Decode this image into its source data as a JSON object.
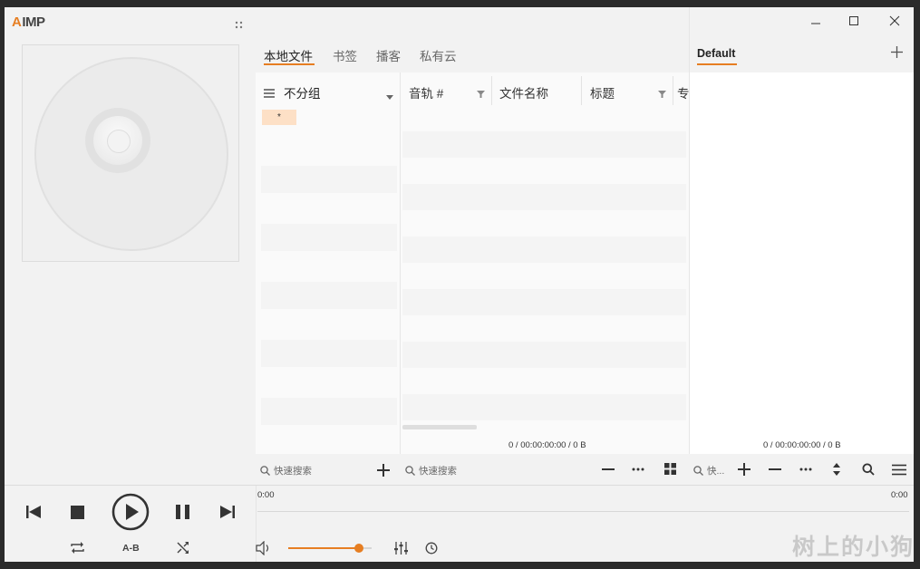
{
  "app": {
    "logo_text": "IMP",
    "logo_accent": "A",
    "accent_color": "#e67e22"
  },
  "tabs": [
    {
      "label": "本地文件",
      "active": true
    },
    {
      "label": "书签",
      "active": false
    },
    {
      "label": "播客",
      "active": false
    },
    {
      "label": "私有云",
      "active": false
    }
  ],
  "grouping": {
    "label": "不分组",
    "all_item": "*"
  },
  "columns": [
    {
      "label": "音轨 #"
    },
    {
      "label": "文件名称"
    },
    {
      "label": "标题"
    },
    {
      "label": "专"
    }
  ],
  "library_status": "0 / 00:00:00:00 / 0 B",
  "playlist": {
    "tab_label": "Default",
    "status": "0 / 00:00:00:00 / 0 B"
  },
  "search": {
    "group_placeholder": "快速搜索",
    "files_placeholder": "快速搜索",
    "playlist_placeholder": "快..."
  },
  "transport": {
    "time_elapsed": "0:00",
    "time_total": "0:00",
    "ab_label": "A-B",
    "volume": 0.85
  },
  "watermark": "树上的小狗"
}
